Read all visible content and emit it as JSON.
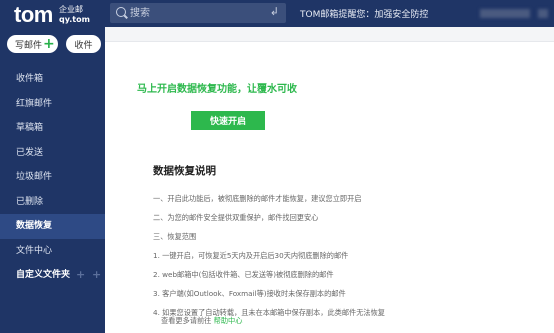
{
  "header": {
    "logo_main": "tom",
    "logo_sub1": "企业邮",
    "logo_sub2": "qy.tom",
    "search_placeholder": "搜索",
    "notice": "TOM邮箱提醒您：加强安全防控"
  },
  "sidebar": {
    "compose_label": "写邮件",
    "receive_label": "收件",
    "items": [
      {
        "label": "收件箱"
      },
      {
        "label": "红旗邮件"
      },
      {
        "label": "草稿箱"
      },
      {
        "label": "已发送"
      },
      {
        "label": "垃圾邮件"
      },
      {
        "label": "已删除"
      },
      {
        "label": "数据恢复"
      },
      {
        "label": "文件中心"
      },
      {
        "label": "自定义文件夹"
      }
    ]
  },
  "main": {
    "headline": "马上开启数据恢复功能，让覆水可收",
    "enable_button": "快速开启",
    "desc_title": "数据恢复说明",
    "desc_lines": [
      "一、开启此功能后，被彻底删除的邮件才能恢复，建议您立即开启",
      "二、为您的邮件安全提供双重保护，邮件找回更安心",
      "三、恢复范围",
      "1. 一键开启，可恢复近5天内及开启后30天内彻底删除的邮件",
      "2. web邮箱中(包括收件箱、已发送等)被彻底删除的邮件",
      "3. 客户端(如Outlook、Foxmail等)接收时未保存副本的邮件",
      "4. 如果您设置了自动转载，且未在本邮箱中保存副本，此类邮件无法恢复"
    ],
    "help_prefix": "查看更多请前往",
    "help_link": "帮助中心"
  },
  "colors": {
    "topbar": "#1f3566",
    "sidebar": "#1f3566",
    "active_item": "#2e4a85",
    "accent_green": "#2db84d"
  }
}
